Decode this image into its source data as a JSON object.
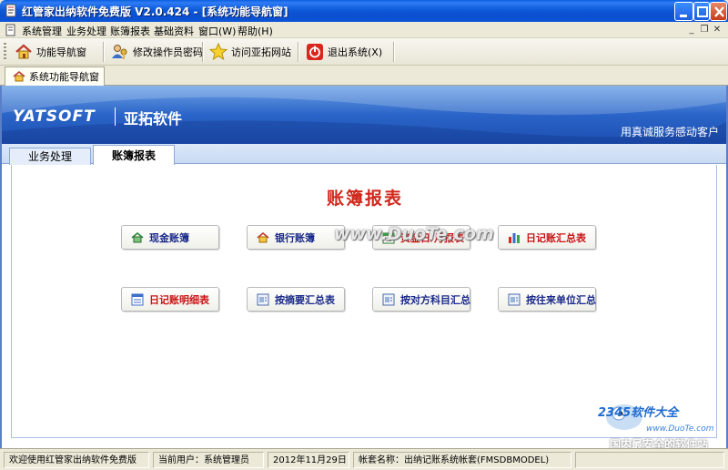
{
  "window": {
    "title": "红管家出纳软件免费版 V2.0.424 - [系统功能导航窗]"
  },
  "menu": {
    "items": [
      "系统管理",
      "业务处理",
      "账簿报表",
      "基础资料",
      "窗口(W)",
      "帮助(H)"
    ]
  },
  "toolbar": {
    "buttons": [
      {
        "label": "功能导航窗",
        "icon": "home-icon"
      },
      {
        "label": "修改操作员密码",
        "icon": "users-key-icon"
      },
      {
        "label": "访问亚拓网站",
        "icon": "star-icon"
      },
      {
        "label": "退出系统(X)",
        "icon": "power-icon"
      }
    ]
  },
  "window_tab": {
    "label": "系统功能导航窗"
  },
  "banner": {
    "logo": "YATSOFT",
    "brand": "亚拓软件",
    "slogan": "用真诚服务感动客户"
  },
  "tabs": [
    {
      "label": "业务处理",
      "active": false
    },
    {
      "label": "账簿报表",
      "active": true
    }
  ],
  "section": {
    "title": "账簿报表"
  },
  "function_buttons": [
    {
      "label": "现金账簿",
      "icon": "house-icon",
      "color": "#1a2a8a"
    },
    {
      "label": "银行账簿",
      "icon": "bank-icon",
      "color": "#1a2a8a"
    },
    {
      "label": "资金日/月报表",
      "icon": "calendar-icon",
      "color": "#c81414"
    },
    {
      "label": "日记账汇总表",
      "icon": "bar-chart-icon",
      "color": "#c81414"
    },
    {
      "label": "日记账明细表",
      "icon": "list-icon",
      "color": "#c81414"
    },
    {
      "label": "按摘要汇总表",
      "icon": "report-icon",
      "color": "#1a2a8a"
    },
    {
      "label": "按对方科目汇总",
      "icon": "report-icon",
      "color": "#1a2a8a"
    },
    {
      "label": "按往来单位汇总",
      "icon": "report-icon",
      "color": "#1a2a8a"
    }
  ],
  "watermarks": {
    "center": "www.DuoTe.com",
    "logo": "2345软件大全",
    "url": "www.DuoTe.com",
    "slogan": "国内最安全的软件站"
  },
  "statusbar": {
    "welcome": "欢迎使用红管家出纳软件免费版",
    "user": "当前用户：系统管理员",
    "date": "2012年11月29日",
    "account": "帐套名称：出纳记账系统帐套(FMSDBMODEL)"
  },
  "colors": {
    "titlebar": "#0a4fd0",
    "banner": "#2a64c8",
    "section_title": "#d0281c",
    "button_text_blue": "#1a2a8a",
    "button_text_red": "#c81414"
  }
}
